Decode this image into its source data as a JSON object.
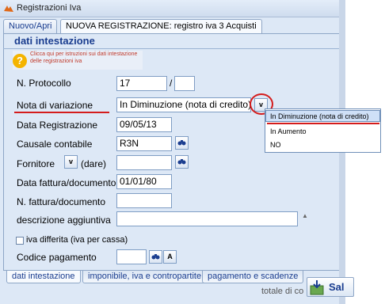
{
  "window": {
    "title": "Registrazioni Iva"
  },
  "tabs": [
    "Nuovo/Apri",
    "NUOVA REGISTRAZIONE: registro iva 3 Acquisti"
  ],
  "section": {
    "title": "dati intestazione",
    "help_text": "Clicca qui per istruzioni sui dati intestazione delle registrazioni iva"
  },
  "form": {
    "protocollo_label": "N. Protocollo",
    "protocollo_value": "17",
    "protocollo_sep": "/",
    "protocollo_suffix": "",
    "nota_label": "Nota di variazione",
    "nota_value": "In Diminuzione (nota di credito)",
    "data_reg_label": "Data Registrazione",
    "data_reg_value": "09/05/13",
    "causale_label": "Causale contabile",
    "causale_value": "R3N",
    "fornitore_label": "Fornitore",
    "fornitore_suffix": "(dare)",
    "fornitore_value": "",
    "data_fattura_label": "Data fattura/documento",
    "data_fattura_value": "01/01/80",
    "num_fattura_label": "N. fattura/documento",
    "num_fattura_value": "",
    "descrizione_label": "descrizione aggiuntiva",
    "descrizione_value": "",
    "iva_differita_label": "iva differita (iva per cassa)",
    "codice_pagamento_label": "Codice pagamento",
    "codice_pagamento_value": "",
    "btn_a": "A",
    "dropdown_btn": "v"
  },
  "dropdown": {
    "options": [
      "In Diminuzione (nota di credito)",
      "In Aumento",
      "NO"
    ],
    "selected_index": 0
  },
  "bottom_tabs": [
    "dati intestazione",
    "imponibile, iva e contropartite",
    "pagamento e scadenze"
  ],
  "footer": {
    "totale_label": "totale di co",
    "save_label": "Sal"
  },
  "colors": {
    "accent_red": "#d41c1c",
    "link_blue": "#1a3d8f"
  }
}
